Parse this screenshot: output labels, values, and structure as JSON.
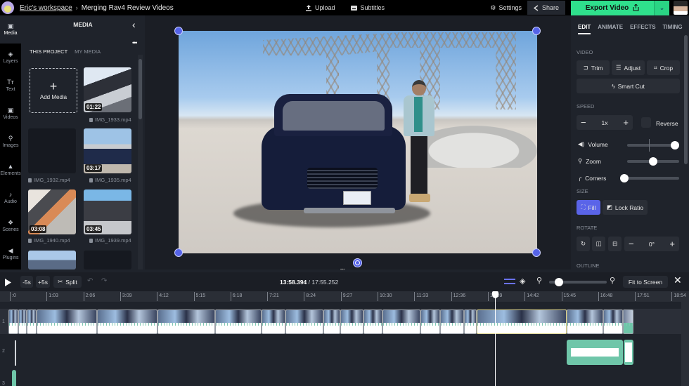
{
  "topbar": {
    "workspace": "Eric's workspace",
    "separator": "›",
    "project_title": "Merging Rav4 Review Videos",
    "upload_label": "Upload",
    "subtitles_label": "Subtitles",
    "settings_label": "Settings",
    "share_label": "Share",
    "export_label": "Export Video",
    "accent_color": "#2fe08c"
  },
  "rail": {
    "items": [
      {
        "label": "Media",
        "icon": "media-icon",
        "glyph": "▣",
        "active": true
      },
      {
        "label": "Layers",
        "icon": "layers-icon",
        "glyph": "◈"
      },
      {
        "label": "Text",
        "icon": "text-icon",
        "glyph": "Tт"
      },
      {
        "label": "Videos",
        "icon": "videos-icon",
        "glyph": "▣"
      },
      {
        "label": "Images",
        "icon": "images-icon",
        "glyph": "⚲"
      },
      {
        "label": "Elements",
        "icon": "elements-icon",
        "glyph": "▲"
      },
      {
        "label": "Audio",
        "icon": "audio-icon",
        "glyph": "♪"
      },
      {
        "label": "Scenes",
        "icon": "scenes-icon",
        "glyph": "❖"
      },
      {
        "label": "Plugins",
        "icon": "plugins-icon",
        "glyph": "◀"
      }
    ]
  },
  "media_panel": {
    "title": "MEDIA",
    "collapse_glyph": "‹",
    "more_glyph": "•••",
    "tabs": [
      "THIS PROJECT",
      "MY MEDIA"
    ],
    "add_media_label": "Add Media",
    "add_glyph": "+",
    "items": [
      {
        "name": "IMG_1933.mp4",
        "duration": "01:22"
      },
      {
        "name": "IMG_1932.mp4",
        "duration": ""
      },
      {
        "name": "IMG_1935.mp4",
        "duration": "03:17"
      },
      {
        "name": "IMG_1940.mp4",
        "duration": "03:08"
      },
      {
        "name": "IMG_1939.mp4",
        "duration": "03:45"
      }
    ]
  },
  "right_panel": {
    "tabs": [
      "EDIT",
      "ANIMATE",
      "EFFECTS",
      "TIMING"
    ],
    "active_tab": "EDIT",
    "video_label": "VIDEO",
    "trim_label": "Trim",
    "adjust_label": "Adjust",
    "crop_label": "Crop",
    "smart_cut_label": "Smart Cut",
    "speed_label": "SPEED",
    "speed_value": "1x",
    "reverse_label": "Reverse",
    "volume_label": "Volume",
    "volume_value": 0.92,
    "zoom_label": "Zoom",
    "zoom_value": 0.5,
    "corners_label": "Corners",
    "corners_value": 0.0,
    "size_label": "SIZE",
    "fill_label": "Fill",
    "lock_ratio_label": "Lock Ratio",
    "rotate_label": "ROTATE",
    "rotate_value": "0°",
    "outline_label": "OUTLINE",
    "fill_color": "#5a64e8"
  },
  "timeline": {
    "skip_back_label": "-5s",
    "skip_fwd_label": "+5s",
    "split_label": "Split",
    "current_time": "13:58.394",
    "total_time": "17:55.252",
    "fit_label": "Fit to Screen",
    "zoom_level": 0.1,
    "ruler": [
      ":0",
      "1:03",
      "2:06",
      "3:09",
      "4:12",
      "5:15",
      "6:18",
      "7:21",
      "8:24",
      "9:27",
      "10:30",
      "11:33",
      "12:36",
      "13:39",
      "14:42",
      "15:45",
      "16:48",
      "17:51",
      "18:54"
    ],
    "track_numbers": [
      "1",
      "2",
      "3"
    ]
  }
}
